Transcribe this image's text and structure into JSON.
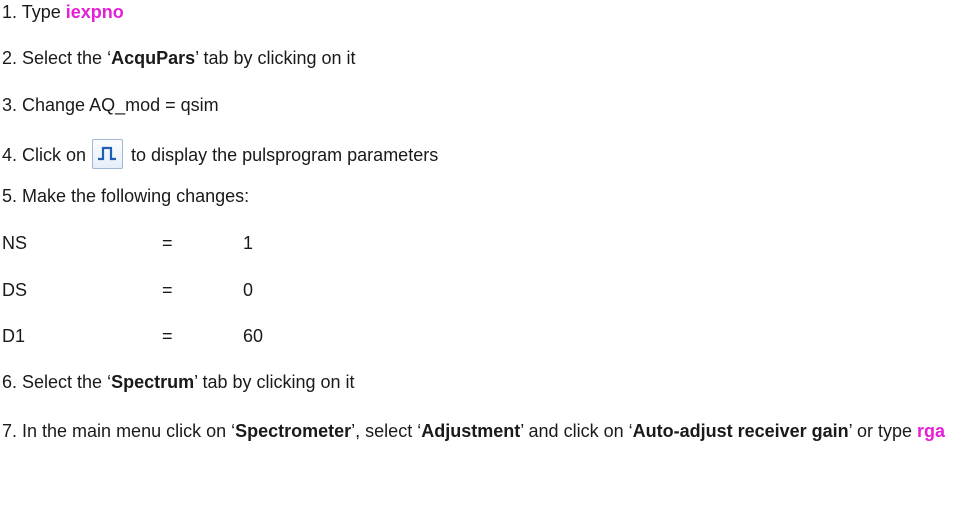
{
  "steps": {
    "s1": {
      "prefix": "1. Type ",
      "command": "iexpno"
    },
    "s2": {
      "prefix": "2. Select the ‘",
      "bold": "AcquPars",
      "suffix": "’ tab by clicking on it"
    },
    "s3": {
      "text": "3. Change AQ_mod = qsim"
    },
    "s4": {
      "prefix": "4. Click on",
      "icon": "pulse-program-icon",
      "suffix": "to display the pulsprogram parameters"
    },
    "s5": {
      "text": "5. Make the following changes:"
    },
    "params": [
      {
        "name": "NS",
        "eq": "=",
        "value": "1"
      },
      {
        "name": "DS",
        "eq": "=",
        "value": "0"
      },
      {
        "name": "D1",
        "eq": "=",
        "value": "60"
      }
    ],
    "s6": {
      "prefix": "6. Select the ‘",
      "bold": "Spectrum",
      "suffix": "’ tab by clicking on it"
    },
    "s7": {
      "prefix": "7. In the main menu click on ‘",
      "bold1": "Spectrometer",
      "mid1": "’, select ‘",
      "bold2": "Adjustment",
      "mid2": "’ and click on ‘",
      "bold3": "Auto-adjust receiver gain",
      "mid3": "’ or type ",
      "command": "rga"
    }
  },
  "colors": {
    "command": "#e61fd6",
    "text": "#1a1a1a",
    "icon_pulse": "#1d5fb0"
  }
}
